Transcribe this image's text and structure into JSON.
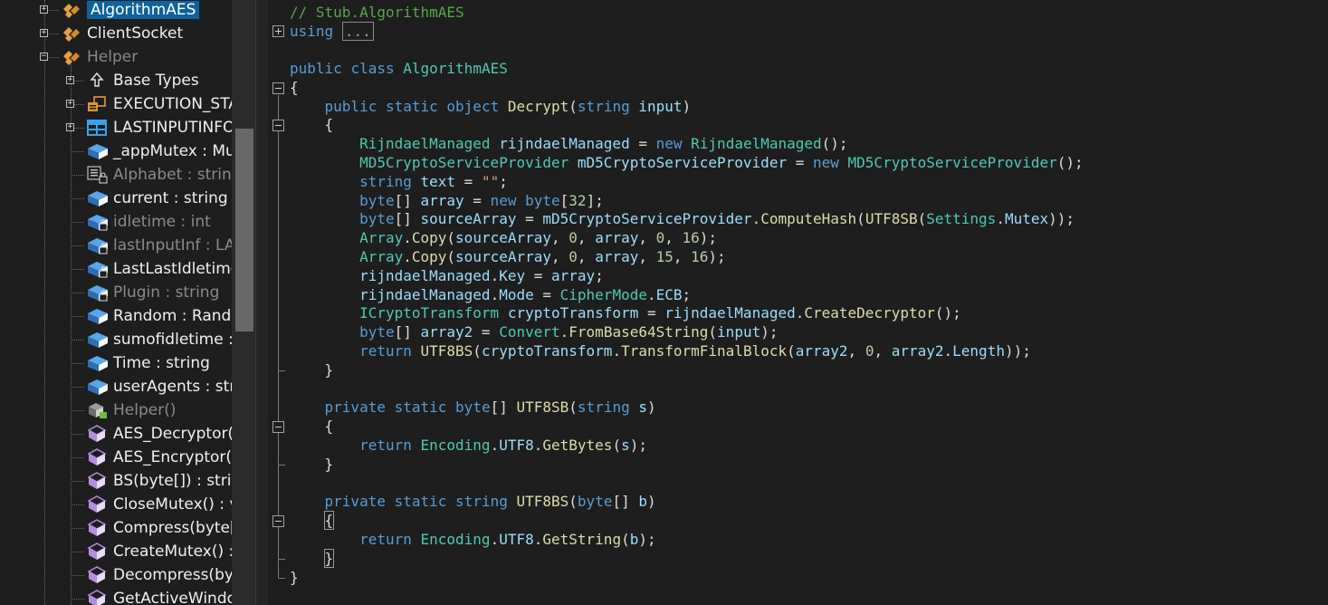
{
  "tree": {
    "items": [
      {
        "label": "AlgorithmAES",
        "selected": true,
        "dim": false,
        "icon": "class-icon"
      },
      {
        "label": "ClientSocket",
        "dim": false,
        "icon": "class-icon"
      },
      {
        "label": "Helper",
        "dim": true,
        "icon": "class-icon"
      },
      {
        "label": "Base Types",
        "dim": false,
        "icon": "base-types-icon"
      },
      {
        "label": "EXECUTION_STA",
        "dim": false,
        "icon": "enum-icon"
      },
      {
        "label": "LASTINPUTINFO",
        "dim": false,
        "icon": "struct-icon"
      },
      {
        "label": "_appMutex : Mu",
        "dim": false,
        "icon": "field-icon"
      },
      {
        "label": "Alphabet : string",
        "dim": true,
        "icon": "constant-icon"
      },
      {
        "label": "current : string",
        "dim": false,
        "icon": "field-icon"
      },
      {
        "label": "idletime : int",
        "dim": true,
        "icon": "private-field-icon"
      },
      {
        "label": "lastInputInf : LA",
        "dim": true,
        "icon": "private-field-icon"
      },
      {
        "label": "LastLastIdletime",
        "dim": false,
        "icon": "private-field-icon"
      },
      {
        "label": "Plugin : string",
        "dim": true,
        "icon": "private-field-icon"
      },
      {
        "label": "Random : Rand",
        "dim": false,
        "icon": "field-icon"
      },
      {
        "label": "sumofidletime :",
        "dim": false,
        "icon": "field-icon"
      },
      {
        "label": "Time : string",
        "dim": false,
        "icon": "field-icon"
      },
      {
        "label": "userAgents : str",
        "dim": false,
        "icon": "field-icon"
      },
      {
        "label": "Helper()",
        "dim": true,
        "icon": "constructor-icon"
      },
      {
        "label": "AES_Decryptor(b",
        "dim": false,
        "icon": "method-icon"
      },
      {
        "label": "AES_Encryptor(b",
        "dim": false,
        "icon": "method-icon"
      },
      {
        "label": "BS(byte[]) : strin",
        "dim": false,
        "icon": "method-icon"
      },
      {
        "label": "CloseMutex() : v",
        "dim": false,
        "icon": "method-icon"
      },
      {
        "label": "Compress(byte[",
        "dim": false,
        "icon": "method-icon"
      },
      {
        "label": "CreateMutex() :",
        "dim": false,
        "icon": "method-icon"
      },
      {
        "label": "Decompress(by",
        "dim": false,
        "icon": "method-icon"
      },
      {
        "label": "GetActiveWindo",
        "dim": false,
        "icon": "method-icon"
      }
    ]
  },
  "code": {
    "comment": "// Stub.AlgorithmAES",
    "using_kw": "using",
    "using_collapsed": "...",
    "lines": [
      [
        [
          "kw",
          "public"
        ],
        [
          "p",
          " "
        ],
        [
          "kw",
          "class"
        ],
        [
          "p",
          " "
        ],
        [
          "ty",
          "AlgorithmAES"
        ]
      ],
      [
        [
          "p",
          "{"
        ]
      ],
      [
        [
          "p",
          "    "
        ],
        [
          "kw",
          "public"
        ],
        [
          "p",
          " "
        ],
        [
          "kw",
          "static"
        ],
        [
          "p",
          " "
        ],
        [
          "kw",
          "object"
        ],
        [
          "p",
          " "
        ],
        [
          "me",
          "Decrypt"
        ],
        [
          "p",
          "("
        ],
        [
          "kw",
          "string"
        ],
        [
          "p",
          " "
        ],
        [
          "va",
          "input"
        ],
        [
          "p",
          ")"
        ]
      ],
      [
        [
          "p",
          "    {"
        ]
      ],
      [
        [
          "p",
          "        "
        ],
        [
          "ty",
          "RijndaelManaged"
        ],
        [
          "p",
          " "
        ],
        [
          "va",
          "rijndaelManaged"
        ],
        [
          "p",
          " = "
        ],
        [
          "kw",
          "new"
        ],
        [
          "p",
          " "
        ],
        [
          "ty",
          "RijndaelManaged"
        ],
        [
          "p",
          "();"
        ]
      ],
      [
        [
          "p",
          "        "
        ],
        [
          "ty",
          "MD5CryptoServiceProvider"
        ],
        [
          "p",
          " "
        ],
        [
          "va",
          "mD5CryptoServiceProvider"
        ],
        [
          "p",
          " = "
        ],
        [
          "kw",
          "new"
        ],
        [
          "p",
          " "
        ],
        [
          "ty",
          "MD5CryptoServiceProvider"
        ],
        [
          "p",
          "();"
        ]
      ],
      [
        [
          "p",
          "        "
        ],
        [
          "kw",
          "string"
        ],
        [
          "p",
          " "
        ],
        [
          "va",
          "text"
        ],
        [
          "p",
          " = "
        ],
        [
          "st",
          "\"\""
        ],
        [
          "p",
          ";"
        ]
      ],
      [
        [
          "p",
          "        "
        ],
        [
          "kw",
          "byte"
        ],
        [
          "p",
          "[] "
        ],
        [
          "va",
          "array"
        ],
        [
          "p",
          " = "
        ],
        [
          "kw",
          "new"
        ],
        [
          "p",
          " "
        ],
        [
          "kw",
          "byte"
        ],
        [
          "p",
          "["
        ],
        [
          "nu",
          "32"
        ],
        [
          "p",
          "];"
        ]
      ],
      [
        [
          "p",
          "        "
        ],
        [
          "kw",
          "byte"
        ],
        [
          "p",
          "[] "
        ],
        [
          "va",
          "sourceArray"
        ],
        [
          "p",
          " = "
        ],
        [
          "va",
          "mD5CryptoServiceProvider"
        ],
        [
          "p",
          "."
        ],
        [
          "me",
          "ComputeHash"
        ],
        [
          "p",
          "("
        ],
        [
          "me",
          "UTF8SB"
        ],
        [
          "p",
          "("
        ],
        [
          "ty",
          "Settings"
        ],
        [
          "p",
          "."
        ],
        [
          "va",
          "Mutex"
        ],
        [
          "p",
          "));"
        ]
      ],
      [
        [
          "p",
          "        "
        ],
        [
          "ty",
          "Array"
        ],
        [
          "p",
          "."
        ],
        [
          "me",
          "Copy"
        ],
        [
          "p",
          "("
        ],
        [
          "va",
          "sourceArray"
        ],
        [
          "p",
          ", "
        ],
        [
          "nu",
          "0"
        ],
        [
          "p",
          ", "
        ],
        [
          "va",
          "array"
        ],
        [
          "p",
          ", "
        ],
        [
          "nu",
          "0"
        ],
        [
          "p",
          ", "
        ],
        [
          "nu",
          "16"
        ],
        [
          "p",
          ");"
        ]
      ],
      [
        [
          "p",
          "        "
        ],
        [
          "ty",
          "Array"
        ],
        [
          "p",
          "."
        ],
        [
          "me",
          "Copy"
        ],
        [
          "p",
          "("
        ],
        [
          "va",
          "sourceArray"
        ],
        [
          "p",
          ", "
        ],
        [
          "nu",
          "0"
        ],
        [
          "p",
          ", "
        ],
        [
          "va",
          "array"
        ],
        [
          "p",
          ", "
        ],
        [
          "nu",
          "15"
        ],
        [
          "p",
          ", "
        ],
        [
          "nu",
          "16"
        ],
        [
          "p",
          ");"
        ]
      ],
      [
        [
          "p",
          "        "
        ],
        [
          "va",
          "rijndaelManaged"
        ],
        [
          "p",
          "."
        ],
        [
          "va",
          "Key"
        ],
        [
          "p",
          " = "
        ],
        [
          "va",
          "array"
        ],
        [
          "p",
          ";"
        ]
      ],
      [
        [
          "p",
          "        "
        ],
        [
          "va",
          "rijndaelManaged"
        ],
        [
          "p",
          "."
        ],
        [
          "va",
          "Mode"
        ],
        [
          "p",
          " = "
        ],
        [
          "ty",
          "CipherMode"
        ],
        [
          "p",
          "."
        ],
        [
          "va",
          "ECB"
        ],
        [
          "p",
          ";"
        ]
      ],
      [
        [
          "p",
          "        "
        ],
        [
          "ty",
          "ICryptoTransform"
        ],
        [
          "p",
          " "
        ],
        [
          "va",
          "cryptoTransform"
        ],
        [
          "p",
          " = "
        ],
        [
          "va",
          "rijndaelManaged"
        ],
        [
          "p",
          "."
        ],
        [
          "me",
          "CreateDecryptor"
        ],
        [
          "p",
          "();"
        ]
      ],
      [
        [
          "p",
          "        "
        ],
        [
          "kw",
          "byte"
        ],
        [
          "p",
          "[] "
        ],
        [
          "va",
          "array2"
        ],
        [
          "p",
          " = "
        ],
        [
          "ty",
          "Convert"
        ],
        [
          "p",
          "."
        ],
        [
          "me",
          "FromBase64String"
        ],
        [
          "p",
          "("
        ],
        [
          "va",
          "input"
        ],
        [
          "p",
          ");"
        ]
      ],
      [
        [
          "p",
          "        "
        ],
        [
          "kw",
          "return"
        ],
        [
          "p",
          " "
        ],
        [
          "me",
          "UTF8BS"
        ],
        [
          "p",
          "("
        ],
        [
          "va",
          "cryptoTransform"
        ],
        [
          "p",
          "."
        ],
        [
          "me",
          "TransformFinalBlock"
        ],
        [
          "p",
          "("
        ],
        [
          "va",
          "array2"
        ],
        [
          "p",
          ", "
        ],
        [
          "nu",
          "0"
        ],
        [
          "p",
          ", "
        ],
        [
          "va",
          "array2"
        ],
        [
          "p",
          "."
        ],
        [
          "va",
          "Length"
        ],
        [
          "p",
          "));"
        ]
      ],
      [
        [
          "p",
          "    }"
        ]
      ],
      [
        [
          "p",
          ""
        ]
      ],
      [
        [
          "p",
          "    "
        ],
        [
          "kw",
          "private"
        ],
        [
          "p",
          " "
        ],
        [
          "kw",
          "static"
        ],
        [
          "p",
          " "
        ],
        [
          "kw",
          "byte"
        ],
        [
          "p",
          "[] "
        ],
        [
          "me",
          "UTF8SB"
        ],
        [
          "p",
          "("
        ],
        [
          "kw",
          "string"
        ],
        [
          "p",
          " "
        ],
        [
          "va",
          "s"
        ],
        [
          "p",
          ")"
        ]
      ],
      [
        [
          "p",
          "    {"
        ]
      ],
      [
        [
          "p",
          "        "
        ],
        [
          "kw",
          "return"
        ],
        [
          "p",
          " "
        ],
        [
          "ty",
          "Encoding"
        ],
        [
          "p",
          "."
        ],
        [
          "va",
          "UTF8"
        ],
        [
          "p",
          "."
        ],
        [
          "me",
          "GetBytes"
        ],
        [
          "p",
          "("
        ],
        [
          "va",
          "s"
        ],
        [
          "p",
          ");"
        ]
      ],
      [
        [
          "p",
          "    }"
        ]
      ],
      [
        [
          "p",
          ""
        ]
      ],
      [
        [
          "p",
          "    "
        ],
        [
          "kw",
          "private"
        ],
        [
          "p",
          " "
        ],
        [
          "kw",
          "static"
        ],
        [
          "p",
          " "
        ],
        [
          "kw",
          "string"
        ],
        [
          "p",
          " "
        ],
        [
          "me",
          "UTF8BS"
        ],
        [
          "p",
          "("
        ],
        [
          "kw",
          "byte"
        ],
        [
          "p",
          "[] "
        ],
        [
          "va",
          "b"
        ],
        [
          "p",
          ")"
        ]
      ],
      [
        [
          "p",
          "    "
        ],
        [
          "hl",
          "{"
        ]
      ],
      [
        [
          "p",
          "        "
        ],
        [
          "kw",
          "return"
        ],
        [
          "p",
          " "
        ],
        [
          "ty",
          "Encoding"
        ],
        [
          "p",
          "."
        ],
        [
          "va",
          "UTF8"
        ],
        [
          "p",
          "."
        ],
        [
          "me",
          "GetString"
        ],
        [
          "p",
          "("
        ],
        [
          "va",
          "b"
        ],
        [
          "p",
          ");"
        ]
      ],
      [
        [
          "p",
          "    "
        ],
        [
          "hl",
          "}"
        ]
      ],
      [
        [
          "p",
          "}"
        ]
      ]
    ]
  }
}
